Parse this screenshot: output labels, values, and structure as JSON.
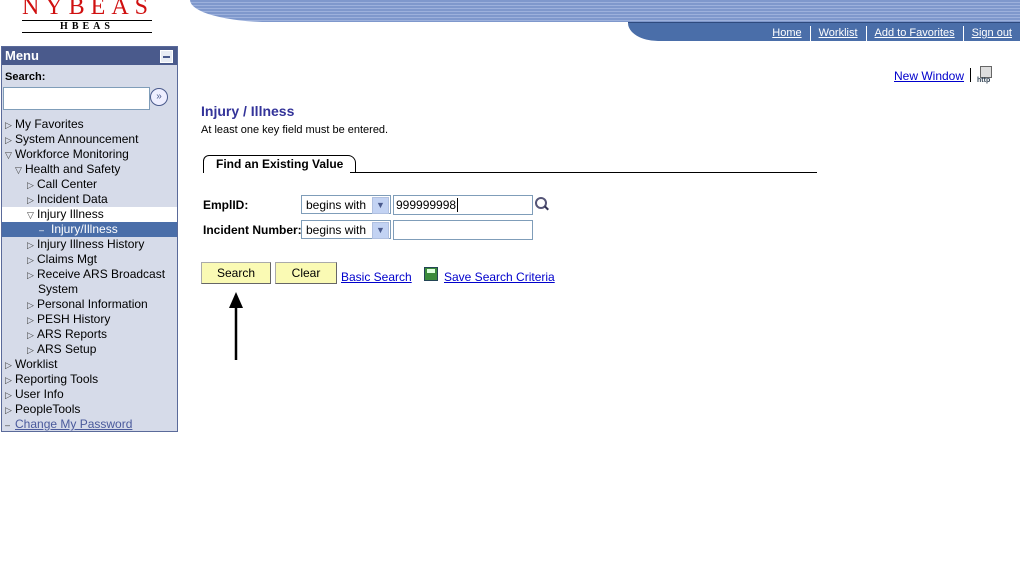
{
  "logo": {
    "title": "NYBEAS",
    "subtitle": "HBEAS"
  },
  "nav": [
    "Home",
    "Worklist",
    "Add to Favorites",
    "Sign out"
  ],
  "new_window": "New Window",
  "http_icon_label": "http",
  "menu": {
    "title": "Menu",
    "search_label": "Search:",
    "search_value": "",
    "items": [
      {
        "label": "My Favorites",
        "level": 0,
        "state": "closed"
      },
      {
        "label": "System Announcement",
        "level": 0,
        "state": "closed"
      },
      {
        "label": "Workforce Monitoring",
        "level": 0,
        "state": "open"
      },
      {
        "label": "Health and Safety",
        "level": 1,
        "state": "open"
      },
      {
        "label": "Call Center",
        "level": 2,
        "state": "closed"
      },
      {
        "label": "Incident Data",
        "level": 2,
        "state": "closed"
      },
      {
        "label": "Injury Illness",
        "level": 2,
        "state": "open"
      },
      {
        "label": "Injury/Illness",
        "level": 3,
        "state": "selected"
      },
      {
        "label": "Injury Illness History",
        "level": 2,
        "state": "closed"
      },
      {
        "label": "Claims Mgt",
        "level": 2,
        "state": "closed"
      },
      {
        "label": "Receive ARS Broadcast",
        "level": 2,
        "state": "closed"
      },
      {
        "label": "System",
        "level": 2,
        "state": "cont"
      },
      {
        "label": "Personal Information",
        "level": 2,
        "state": "closed"
      },
      {
        "label": "PESH History",
        "level": 2,
        "state": "closed"
      },
      {
        "label": "ARS Reports",
        "level": 2,
        "state": "closed"
      },
      {
        "label": "ARS Setup",
        "level": 2,
        "state": "closed"
      },
      {
        "label": "Worklist",
        "level": 0,
        "state": "closed"
      },
      {
        "label": "Reporting Tools",
        "level": 0,
        "state": "closed"
      },
      {
        "label": "User Info",
        "level": 0,
        "state": "closed"
      },
      {
        "label": "PeopleTools",
        "level": 0,
        "state": "closed"
      },
      {
        "label": "Change My Password",
        "level": 0,
        "state": "link"
      }
    ]
  },
  "page": {
    "title": "Injury / Illness",
    "instruction": "At least one key field must be entered.",
    "tab": "Find an Existing Value",
    "fields": [
      {
        "label": "EmplID:",
        "operator": "begins with",
        "value": "999999998"
      },
      {
        "label": "Incident Number:",
        "operator": "begins with",
        "value": ""
      }
    ],
    "search_button": "Search",
    "clear_button": "Clear",
    "basic_search": "Basic Search",
    "save_criteria": "Save Search Criteria"
  }
}
